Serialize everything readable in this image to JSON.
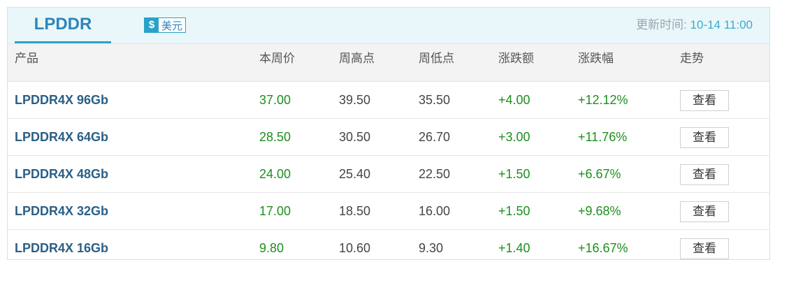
{
  "tab": {
    "label": "LPDDR"
  },
  "currency": {
    "symbol": "$",
    "label": "美元"
  },
  "update": {
    "label": "更新时间: ",
    "value": "10-14 11:00"
  },
  "table": {
    "headers": [
      "产品",
      "本周价",
      "周高点",
      "周低点",
      "涨跌额",
      "涨跌幅",
      "走势"
    ],
    "rows": [
      {
        "product": "LPDDR4X 96Gb",
        "price": "37.00",
        "high": "39.50",
        "low": "35.50",
        "change": "+4.00",
        "pct": "+12.12%",
        "action": "查看"
      },
      {
        "product": "LPDDR4X 64Gb",
        "price": "28.50",
        "high": "30.50",
        "low": "26.70",
        "change": "+3.00",
        "pct": "+11.76%",
        "action": "查看"
      },
      {
        "product": "LPDDR4X 48Gb",
        "price": "24.00",
        "high": "25.40",
        "low": "22.50",
        "change": "+1.50",
        "pct": "+6.67%",
        "action": "查看"
      },
      {
        "product": "LPDDR4X 32Gb",
        "price": "17.00",
        "high": "18.50",
        "low": "16.00",
        "change": "+1.50",
        "pct": "+9.68%",
        "action": "查看"
      },
      {
        "product": "LPDDR4X 16Gb",
        "price": "9.80",
        "high": "10.60",
        "low": "9.30",
        "change": "+1.40",
        "pct": "+16.67%",
        "action": "查看"
      }
    ]
  },
  "colors": {
    "accent": "#2aa2c8",
    "title": "#2e86b8",
    "product": "#2b5f86",
    "up": "#1d8f1d"
  }
}
